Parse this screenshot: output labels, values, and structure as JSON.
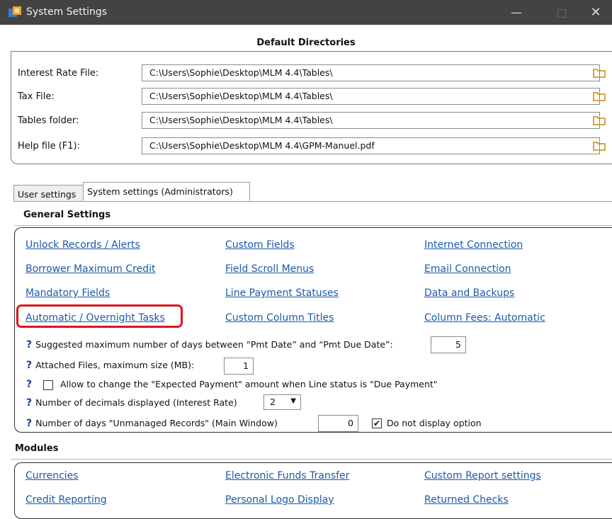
{
  "window": {
    "title": "System Settings",
    "minimize_glyph": "—",
    "close_glyph": "✕"
  },
  "default_directories": {
    "title": "Default Directories",
    "rows": [
      {
        "label": "Interest Rate File:",
        "value": "C:\\Users\\Sophie\\Desktop\\MLM 4.4\\Tables\\"
      },
      {
        "label": "Tax File:",
        "value": "C:\\Users\\Sophie\\Desktop\\MLM 4.4\\Tables\\"
      },
      {
        "label": "Tables folder:",
        "value": "C:\\Users\\Sophie\\Desktop\\MLM 4.4\\Tables\\"
      },
      {
        "label": "Help file (F1):",
        "value": "C:\\Users\\Sophie\\Desktop\\MLM 4.4\\GPM-Manuel.pdf"
      }
    ]
  },
  "tabs": [
    {
      "label": "User settings",
      "active": false
    },
    {
      "label": "System settings (Administrators)",
      "active": true
    }
  ],
  "general": {
    "title": "General Settings",
    "links": {
      "unlock": "Unlock Records / Alerts",
      "custom_fields": "Custom Fields",
      "internet": "Internet Connection",
      "borrower_max": "Borrower Maximum Credit",
      "field_scroll": "Field Scroll Menus",
      "email": "Email Connection",
      "mandatory": "Mandatory Fields",
      "line_payment": "Line Payment Statuses",
      "data_backups": "Data and Backups",
      "automatic": "Automatic / Overnight Tasks",
      "custom_col_titles": "Custom Column Titles",
      "column_fees": "Column Fees: Automatic"
    },
    "options": {
      "q_mark": "?",
      "max_days_label": "Suggested maximum number of days between “Pmt Date” and “Pmt Due Date”:",
      "max_days_value": "5",
      "attached_label": "Attached Files, maximum size (MB):",
      "attached_value": "1",
      "allow_change_label": "Allow to change the \"Expected Payment\" amount when Line status is \"Due Payment\"",
      "decimals_label": "Number of decimals displayed (Interest Rate)",
      "decimals_value": "2",
      "unmanaged_label": "Number of days \"Unmanaged Records\" (Main Window)",
      "unmanaged_value": "0",
      "do_not_display_label": "Do not display option",
      "check_mark": "✔",
      "dropdown_arrow": "▼"
    }
  },
  "modules": {
    "title": "Modules",
    "links": {
      "currencies": "Currencies",
      "eft": "Electronic Funds Transfer",
      "custom_report": "Custom Report settings",
      "credit_reporting": "Credit Reporting",
      "personal_logo": "Personal Logo Display",
      "returned_checks": "Returned Checks"
    }
  },
  "colors": {
    "link": "#1a5aa8",
    "highlight": "#e0141e",
    "titlebar": "#434343"
  }
}
